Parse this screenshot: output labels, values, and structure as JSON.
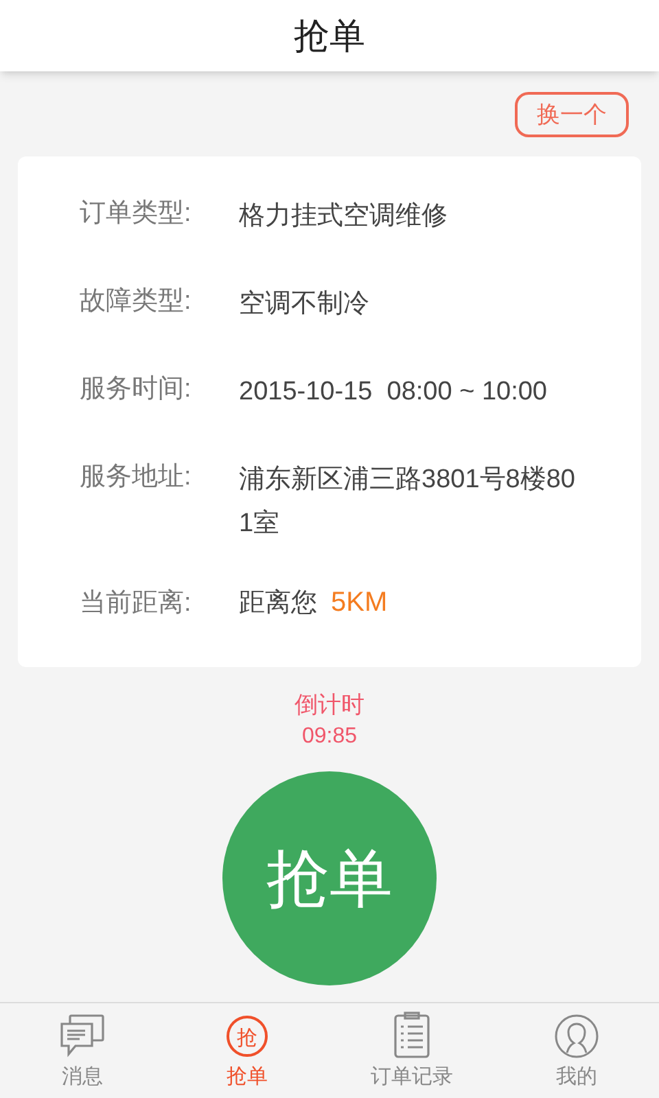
{
  "header": {
    "title": "抢单"
  },
  "switch_button": {
    "label": "换一个"
  },
  "order": {
    "rows": [
      {
        "kind": "text",
        "label": "订单类型:",
        "value": "格力挂式空调维修"
      },
      {
        "kind": "text",
        "label": "故障类型:",
        "value": "空调不制冷"
      },
      {
        "kind": "text",
        "label": "服务时间:",
        "value": "2015-10-15  08:00 ~ 10:00"
      },
      {
        "kind": "text",
        "label": "服务地址:",
        "value": "浦东新区浦三路3801号8楼801室"
      },
      {
        "kind": "distance",
        "label": "当前距离:",
        "value": "距离您",
        "highlight": "5KM"
      }
    ]
  },
  "countdown": {
    "label": "倒计时",
    "time": "09:85"
  },
  "grab_button": {
    "label": "抢单"
  },
  "tabs": [
    {
      "kind": "messages",
      "label": "消息",
      "selected": false
    },
    {
      "kind": "grab",
      "label": "抢单",
      "icon_text": "抢",
      "selected": true
    },
    {
      "kind": "orders",
      "label": "订单记录",
      "selected": false
    },
    {
      "kind": "profile",
      "label": "我的",
      "selected": false
    }
  ]
}
